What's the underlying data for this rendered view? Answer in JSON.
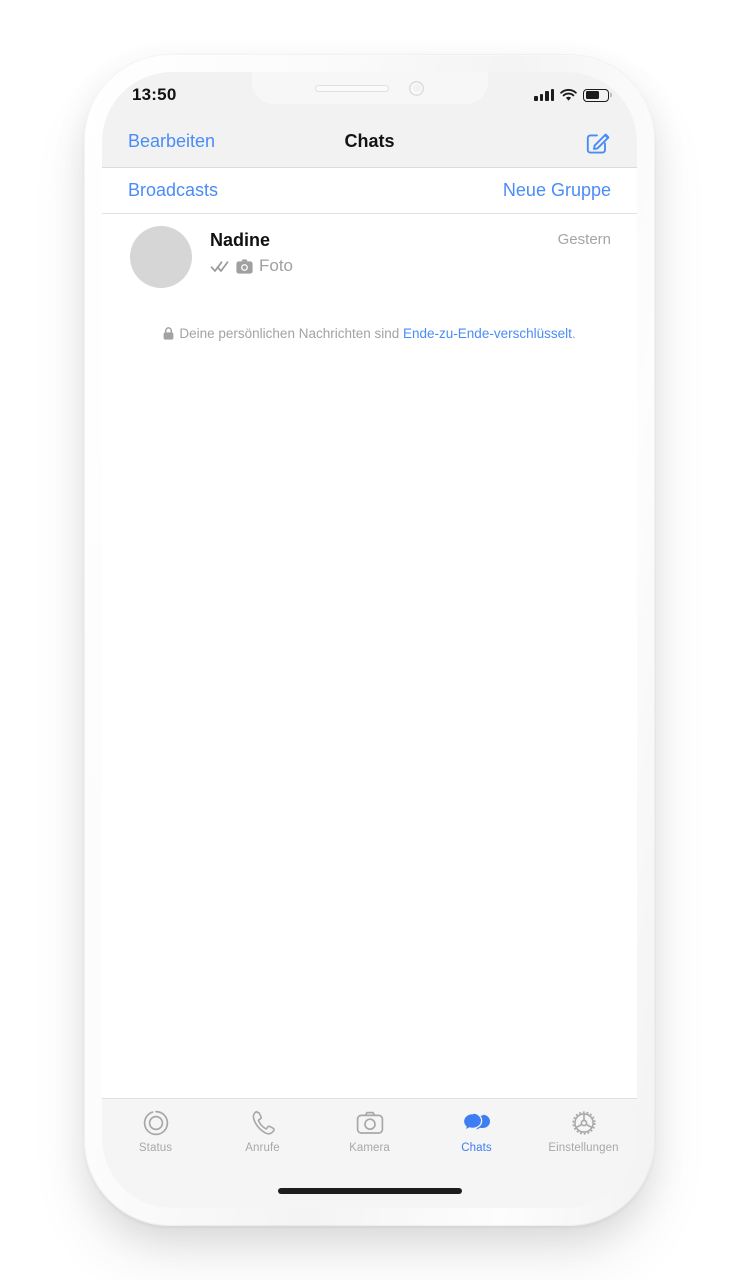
{
  "status_bar": {
    "time": "13:50",
    "signal_icon": "cellular-bars-icon",
    "signal_bars": 4,
    "wifi_icon": "wifi-icon",
    "battery_icon": "battery-icon",
    "battery_level_percent": 62
  },
  "nav_bar": {
    "edit_label": "Bearbeiten",
    "title": "Chats",
    "compose_icon": "compose-icon"
  },
  "sub_bar": {
    "broadcasts_label": "Broadcasts",
    "new_group_label": "Neue Gruppe"
  },
  "chats": [
    {
      "avatar_icon": "avatar-placeholder",
      "name": "Nadine",
      "status_icon": "double-check-icon",
      "media_icon": "camera-icon",
      "preview": "Foto",
      "time": "Gestern"
    }
  ],
  "encryption_notice": {
    "lock_icon": "lock-icon",
    "text_prefix": "Deine persönlichen Nachrichten sind ",
    "link_text": "Ende-zu-Ende-verschlüsselt",
    "text_suffix": "."
  },
  "tab_bar": {
    "items": [
      {
        "icon": "status-rings-icon",
        "label": "Status",
        "active": false
      },
      {
        "icon": "phone-icon",
        "label": "Anrufe",
        "active": false
      },
      {
        "icon": "camera-outline-icon",
        "label": "Kamera",
        "active": false
      },
      {
        "icon": "chat-bubbles-icon",
        "label": "Chats",
        "active": true
      },
      {
        "icon": "gear-icon",
        "label": "Einstellungen",
        "active": false
      }
    ]
  },
  "colors": {
    "accent_blue": "#4a8cf7",
    "tab_active_blue": "#3d7ef2",
    "nav_background": "#f2f2f2",
    "tab_background": "#f5f5f5",
    "avatar_grey": "#d6d6d6",
    "secondary_text": "#a0a0a0"
  },
  "home_indicator": "home-indicator"
}
